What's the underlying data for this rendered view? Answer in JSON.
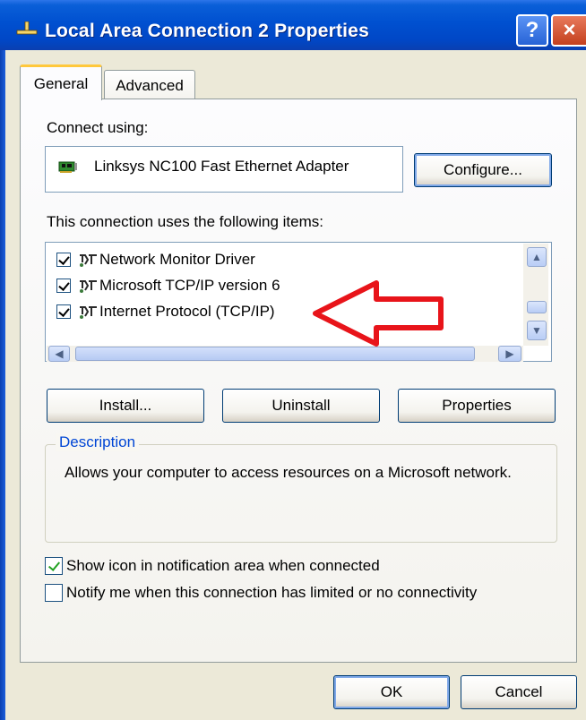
{
  "window": {
    "title": "Local Area Connection 2 Properties",
    "help_glyph": "?",
    "close_glyph": "×"
  },
  "tabs": [
    {
      "label": "General",
      "active": true
    },
    {
      "label": "Advanced",
      "active": false
    }
  ],
  "connect_using": {
    "label": "Connect using:",
    "adapter": "Linksys NC100 Fast Ethernet Adapter",
    "adapter_icon": "network-card-icon",
    "configure_button": "Configure..."
  },
  "items": {
    "label": "This connection uses the following items:",
    "list": [
      {
        "label": "Network Monitor Driver",
        "checked": true,
        "icon": "network-protocol-icon"
      },
      {
        "label": "Microsoft TCP/IP version 6",
        "checked": true,
        "icon": "network-protocol-icon"
      },
      {
        "label": "Internet Protocol (TCP/IP)",
        "checked": true,
        "icon": "network-protocol-icon"
      }
    ]
  },
  "buttons": {
    "install": "Install...",
    "uninstall": "Uninstall",
    "properties": "Properties"
  },
  "description": {
    "legend": "Description",
    "text": "Allows your computer to access resources on a Microsoft network."
  },
  "options": [
    {
      "label": "Show icon in notification area when connected",
      "checked": true
    },
    {
      "label": "Notify me when this connection has limited or no connectivity",
      "checked": false
    }
  ],
  "footer": {
    "ok": "OK",
    "cancel": "Cancel"
  },
  "annotation": {
    "color": "#e8141a",
    "icon": "red-arrow-icon"
  },
  "colors": {
    "titlebar": "#0050d0",
    "accent": "#0046d5"
  }
}
